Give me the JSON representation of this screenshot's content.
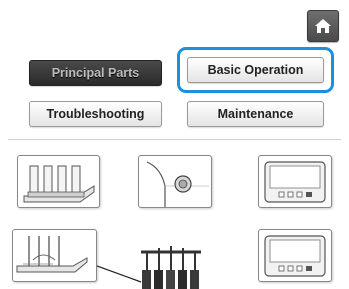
{
  "header": {
    "home_icon": "home-icon"
  },
  "buttons": {
    "principal_parts": "Principal Parts",
    "basic_operation": "Basic Operation",
    "troubleshooting": "Troubleshooting",
    "maintenance": "Maintenance"
  },
  "selected_button": "principal_parts",
  "highlighted_button": "basic_operation",
  "colors": {
    "highlight": "#1e8fdc",
    "selected_bg": "#2a2a2a",
    "button_bg": "#f0f0f0"
  },
  "thumbnails": [
    {
      "name": "thread-spool-stand-thumb",
      "icon": "spool-stand-icon"
    },
    {
      "name": "side-knob-thumb",
      "icon": "knob-icon"
    },
    {
      "name": "lcd-panel-thumb-1",
      "icon": "display-panel-icon"
    },
    {
      "name": "spool-pins-thumb",
      "icon": "spool-pins-icon"
    },
    {
      "name": "lcd-panel-thumb-2",
      "icon": "display-panel-icon"
    }
  ]
}
